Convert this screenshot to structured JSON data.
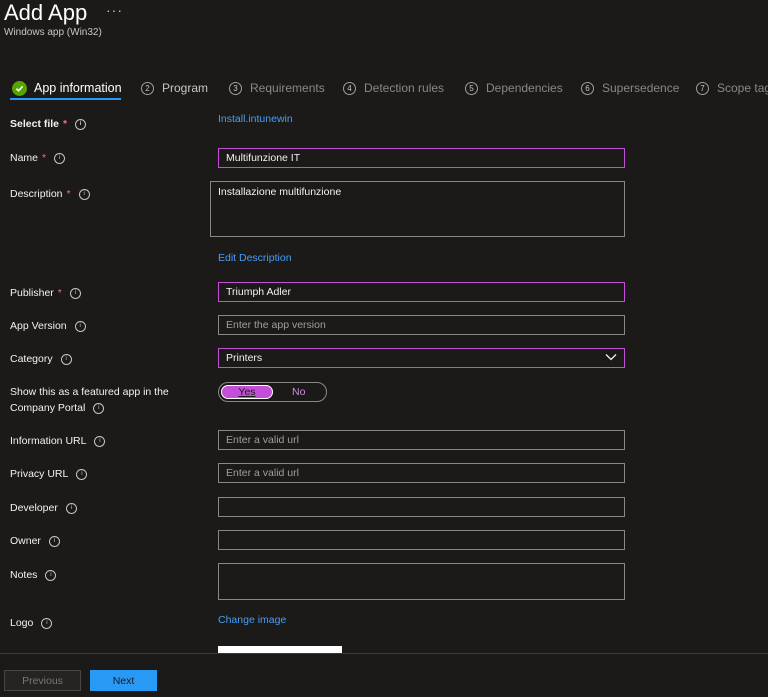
{
  "header": {
    "title": "Add App",
    "more": "···",
    "subtitle": "Windows app (Win32)"
  },
  "steps": [
    {
      "number": "",
      "label": "App information",
      "state": "active"
    },
    {
      "number": "2",
      "label": "Program",
      "state": "done"
    },
    {
      "number": "3",
      "label": "Requirements",
      "state": "pending"
    },
    {
      "number": "4",
      "label": "Detection rules",
      "state": "pending"
    },
    {
      "number": "5",
      "label": "Dependencies",
      "state": "pending"
    },
    {
      "number": "6",
      "label": "Supersedence",
      "state": "pending"
    },
    {
      "number": "7",
      "label": "Scope tag",
      "state": "pending"
    }
  ],
  "form": {
    "select_file": {
      "label": "Select file",
      "required": "*",
      "link": "Install.intunewin"
    },
    "name": {
      "label": "Name",
      "required": "*",
      "value": "Multifunzione IT"
    },
    "description": {
      "label": "Description",
      "required": "*",
      "value": "Installazione multifunzione",
      "edit_link": "Edit Description"
    },
    "publisher": {
      "label": "Publisher",
      "required": "*",
      "value": "Triumph Adler"
    },
    "app_version": {
      "label": "App Version",
      "placeholder": "Enter the app version"
    },
    "category": {
      "label": "Category",
      "value": "Printers"
    },
    "featured": {
      "label_line1": "Show this as a featured app in the",
      "label_line2": "Company Portal",
      "yes": "Yes",
      "no": "No",
      "selected": "Yes"
    },
    "information_url": {
      "label": "Information URL",
      "placeholder": "Enter a valid url"
    },
    "privacy_url": {
      "label": "Privacy URL",
      "placeholder": "Enter a valid url"
    },
    "developer": {
      "label": "Developer",
      "value": ""
    },
    "owner": {
      "label": "Owner",
      "value": ""
    },
    "notes": {
      "label": "Notes",
      "value": ""
    },
    "logo": {
      "label": "Logo",
      "link": "Change image"
    }
  },
  "footer": {
    "previous": "Previous",
    "next": "Next"
  },
  "icons": {
    "info": "i",
    "check": "checkmark-icon",
    "chevron": "chevron-down-icon"
  },
  "colors": {
    "background": "#1b1a19",
    "accent_blue": "#2899f5",
    "link": "#479ef5",
    "focus_purple": "#c34fd8",
    "required_red": "#f1707b",
    "success_green": "#57a300"
  }
}
